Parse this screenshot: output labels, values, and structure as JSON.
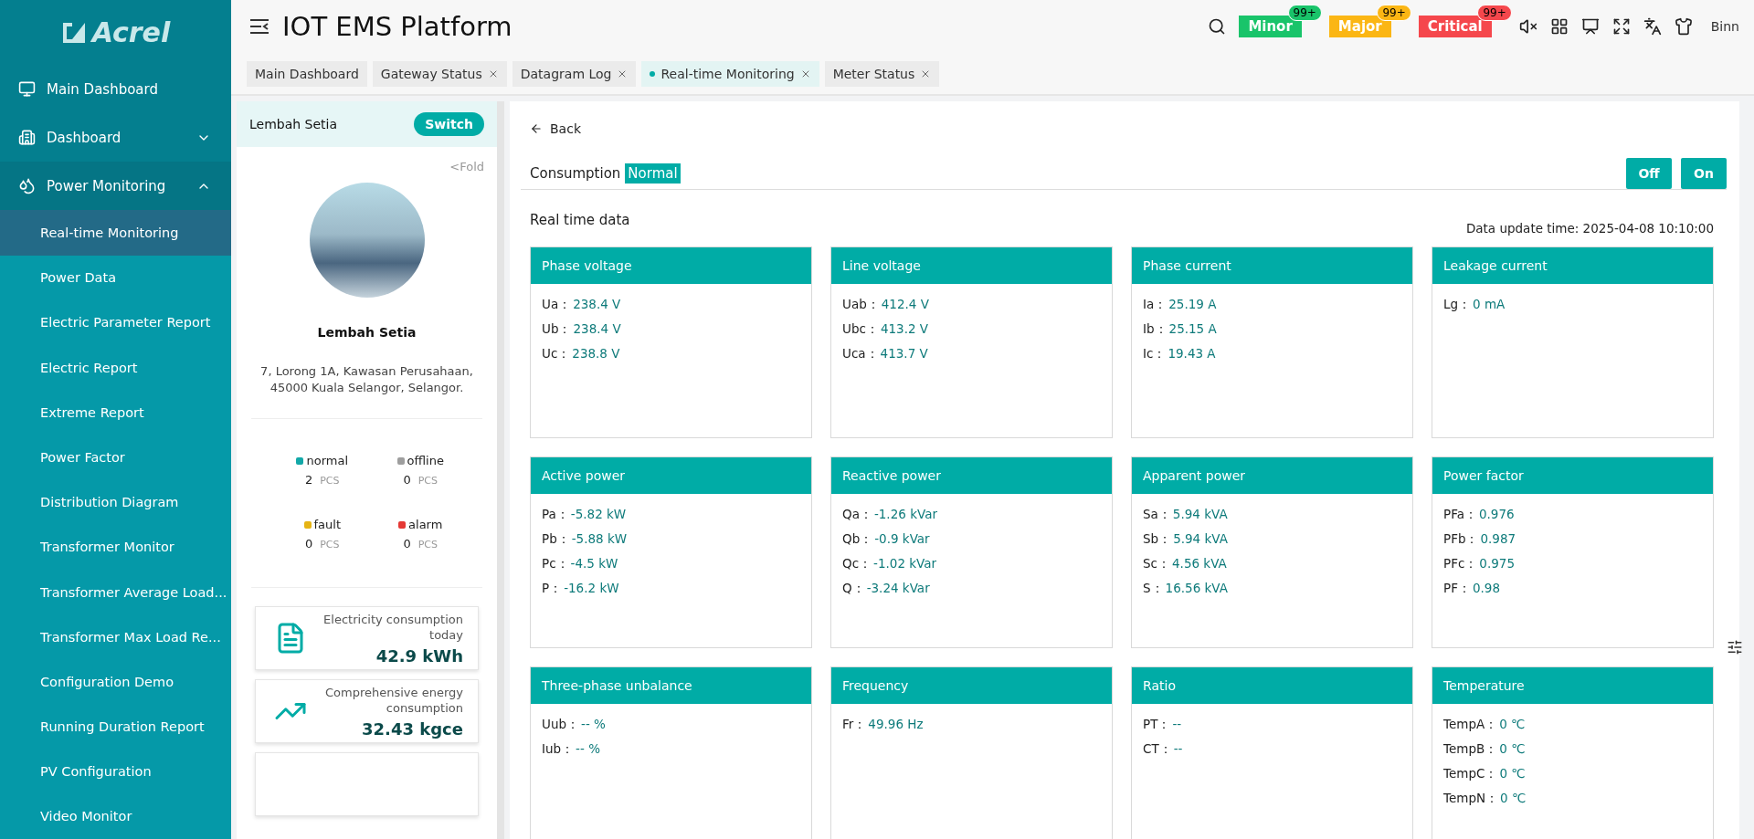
{
  "sidebar": {
    "logo": "Acrel",
    "items": [
      {
        "kind": "link",
        "label": "Main Dashboard"
      },
      {
        "kind": "group",
        "label": "Dashboard",
        "expanded": false
      },
      {
        "kind": "group",
        "label": "Power Monitoring",
        "expanded": true,
        "children": [
          {
            "label": "Real-time Monitoring",
            "selected": true
          },
          {
            "label": "Power Data",
            "selected": false
          },
          {
            "label": "Electric Parameter Report",
            "selected": false
          },
          {
            "label": "Electric Report",
            "selected": false
          },
          {
            "label": "Extreme Report",
            "selected": false
          },
          {
            "label": "Power Factor",
            "selected": false
          },
          {
            "label": "Distribution Diagram",
            "selected": false
          },
          {
            "label": "Transformer Monitor",
            "selected": false
          },
          {
            "label": "Transformer Average Load...",
            "selected": false
          },
          {
            "label": "Transformer Max Load Re...",
            "selected": false
          },
          {
            "label": "Configuration Demo",
            "selected": false
          },
          {
            "label": "Running Duration Report",
            "selected": false
          },
          {
            "label": "PV Configuration",
            "selected": false
          },
          {
            "label": "Video Monitor",
            "selected": false
          }
        ]
      }
    ]
  },
  "header": {
    "title": "IOT EMS Platform",
    "alerts": [
      {
        "label": "Minor",
        "count": "99+",
        "color": "#19c46a"
      },
      {
        "label": "Major",
        "count": "99+",
        "color": "#fbb614"
      },
      {
        "label": "Critical",
        "count": "99+",
        "color": "#f5474c"
      }
    ],
    "user": "Binn"
  },
  "tabs": [
    {
      "label": "Main Dashboard",
      "selected": false,
      "closable": false
    },
    {
      "label": "Gateway Status",
      "selected": false,
      "closable": true
    },
    {
      "label": "Datagram Log",
      "selected": false,
      "closable": true
    },
    {
      "label": "Real-time Monitoring",
      "selected": true,
      "closable": true
    },
    {
      "label": "Meter Status",
      "selected": false,
      "closable": true
    }
  ],
  "site": {
    "name": "Lembah Setia",
    "switch": "Switch",
    "fold": "<Fold",
    "title": "Lembah Setia",
    "address": "7, Lorong 1A, Kawasan Perusahaan, 45000 Kuala Selangor, Selangor.",
    "statuses": [
      {
        "label": "normal",
        "count": "2",
        "unit": "PCS",
        "color": "#13a8a8"
      },
      {
        "label": "offline",
        "count": "0",
        "unit": "PCS",
        "color": "#9e9e9e"
      },
      {
        "label": "fault",
        "count": "0",
        "unit": "PCS",
        "color": "#e6b414"
      },
      {
        "label": "alarm",
        "count": "0",
        "unit": "PCS",
        "color": "#e53935"
      }
    ],
    "stats": [
      {
        "label": "Electricity consumption today",
        "value": "42.9 kWh"
      },
      {
        "label": "Comprehensive energy consumption",
        "value": "32.43 kgce"
      }
    ]
  },
  "main": {
    "back": "Back",
    "consumption": "Consumption",
    "consumption_status": "Normal",
    "buttons": [
      "Off",
      "On"
    ],
    "section": "Real time data",
    "update_time": "Data update time: 2025-04-08 10:10:00",
    "cards": [
      {
        "title": "Phase voltage",
        "rows": [
          {
            "label": "Ua：",
            "reading": "238.4 V"
          },
          {
            "label": "Ub：",
            "reading": "238.4 V"
          },
          {
            "label": "Uc：",
            "reading": "238.8 V"
          }
        ]
      },
      {
        "title": "Line voltage",
        "rows": [
          {
            "label": "Uab：",
            "reading": "412.4 V"
          },
          {
            "label": "Ubc：",
            "reading": "413.2 V"
          },
          {
            "label": "Uca：",
            "reading": "413.7 V"
          }
        ]
      },
      {
        "title": "Phase current",
        "rows": [
          {
            "label": "Ia：",
            "reading": "25.19 A"
          },
          {
            "label": "Ib：",
            "reading": "25.15 A"
          },
          {
            "label": "Ic：",
            "reading": "19.43 A"
          }
        ]
      },
      {
        "title": "Leakage current",
        "rows": [
          {
            "label": "Lg：",
            "reading": "0 mA"
          }
        ]
      },
      {
        "title": "Active power",
        "rows": [
          {
            "label": "Pa：",
            "reading": "-5.82 kW"
          },
          {
            "label": "Pb：",
            "reading": "-5.88 kW"
          },
          {
            "label": "Pc：",
            "reading": "-4.5 kW"
          },
          {
            "label": "P：",
            "reading": "-16.2 kW"
          }
        ]
      },
      {
        "title": "Reactive power",
        "rows": [
          {
            "label": "Qa：",
            "reading": "-1.26 kVar"
          },
          {
            "label": "Qb：",
            "reading": "-0.9 kVar"
          },
          {
            "label": "Qc：",
            "reading": "-1.02 kVar"
          },
          {
            "label": "Q：",
            "reading": "-3.24 kVar"
          }
        ]
      },
      {
        "title": "Apparent power",
        "rows": [
          {
            "label": "Sa：",
            "reading": "5.94 kVA"
          },
          {
            "label": "Sb：",
            "reading": "5.94 kVA"
          },
          {
            "label": "Sc：",
            "reading": "4.56 kVA"
          },
          {
            "label": "S：",
            "reading": "16.56 kVA"
          }
        ]
      },
      {
        "title": "Power factor",
        "rows": [
          {
            "label": "PFa：",
            "reading": "0.976"
          },
          {
            "label": "PFb：",
            "reading": "0.987"
          },
          {
            "label": "PFc：",
            "reading": "0.975"
          },
          {
            "label": "PF：",
            "reading": "0.98"
          }
        ]
      },
      {
        "title": "Three-phase unbalance",
        "rows": [
          {
            "label": "Uub：",
            "reading": "-- %"
          },
          {
            "label": "Iub：",
            "reading": "-- %"
          }
        ]
      },
      {
        "title": "Frequency",
        "rows": [
          {
            "label": "Fr：",
            "reading": "49.96 Hz"
          }
        ]
      },
      {
        "title": "Ratio",
        "rows": [
          {
            "label": "PT：",
            "reading": "--"
          },
          {
            "label": "CT：",
            "reading": "--"
          }
        ]
      },
      {
        "title": "Temperature",
        "rows": [
          {
            "label": "TempA：",
            "reading": "0 ℃"
          },
          {
            "label": "TempB：",
            "reading": "0 ℃"
          },
          {
            "label": "TempC：",
            "reading": "0 ℃"
          },
          {
            "label": "TempN：",
            "reading": "0 ℃"
          }
        ]
      }
    ]
  }
}
